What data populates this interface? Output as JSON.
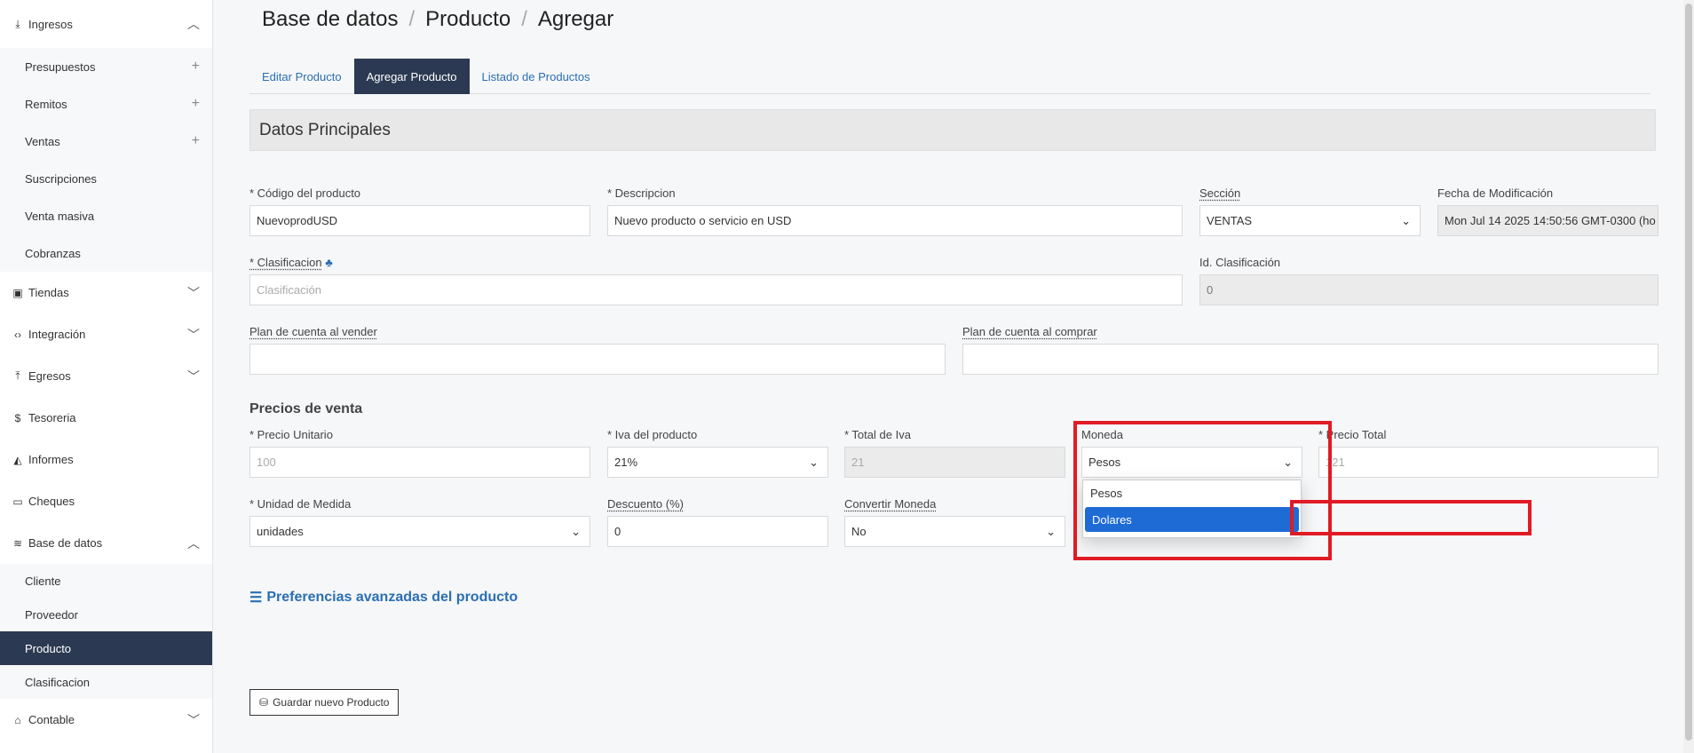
{
  "sidebar": {
    "ingresos": {
      "label": "Ingresos",
      "icon": "download-icon"
    },
    "ingresos_items": [
      {
        "label": "Presupuestos",
        "plus": "+"
      },
      {
        "label": "Remitos",
        "plus": "+"
      },
      {
        "label": "Ventas",
        "plus": "+"
      },
      {
        "label": "Suscripciones",
        "plus": ""
      },
      {
        "label": "Venta masiva",
        "plus": ""
      },
      {
        "label": "Cobranzas",
        "plus": ""
      }
    ],
    "tiendas": "Tiendas",
    "integracion": "Integración",
    "egresos": "Egresos",
    "tesoreria": "Tesoreria",
    "informes": "Informes",
    "cheques": "Cheques",
    "base_datos": "Base de datos",
    "base_items": [
      "Cliente",
      "Proveedor",
      "Producto",
      "Clasificacion"
    ],
    "contable": "Contable"
  },
  "breadcrumb": {
    "part1": "Base de datos",
    "part2": "Producto",
    "part3": "Agregar",
    "sep": "/"
  },
  "tabs": [
    "Editar Producto",
    "Agregar Producto",
    "Listado de Productos"
  ],
  "section_title": "Datos Principales",
  "fields": {
    "codigo": {
      "label": "* Código del producto",
      "value": "NuevoprodUSD"
    },
    "descripcion": {
      "label": "* Descripcion",
      "value": "Nuevo producto o servicio en USD"
    },
    "seccion": {
      "label": "Sección",
      "value": "VENTAS"
    },
    "fecha": {
      "label": "Fecha de Modificación",
      "value": "Mon Jul 14 2025 14:50:56 GMT-0300 (ho"
    },
    "clasificacion": {
      "label": "* Clasificacion",
      "placeholder": "Clasificación"
    },
    "id_clasificacion": {
      "label": "Id. Clasificación",
      "value": "0"
    },
    "plan_vender": {
      "label": "Plan de cuenta al vender",
      "value": ""
    },
    "plan_comprar": {
      "label": "Plan de cuenta al comprar",
      "value": ""
    },
    "precio_unitario": {
      "label": "* Precio Unitario",
      "placeholder": "100"
    },
    "iva": {
      "label": "* Iva del producto",
      "value": "21%"
    },
    "total_iva": {
      "label": "* Total de Iva",
      "value": "21"
    },
    "moneda": {
      "label": "Moneda",
      "value": "Pesos"
    },
    "precio_total": {
      "label": "* Precio Total",
      "placeholder": "121"
    },
    "unidad": {
      "label": "* Unidad de Medida",
      "value": "unidades"
    },
    "descuento": {
      "label": "Descuento (%)",
      "value": "0"
    },
    "convertir": {
      "label": "Convertir Moneda",
      "value": "No"
    }
  },
  "precios_heading": "Precios de venta",
  "moneda_options": [
    "Pesos",
    "Dolares"
  ],
  "advanced_link": "Preferencias avanzadas del producto",
  "save_button": "Guardar nuevo Producto",
  "colors": {
    "primary_dark": "#2b3a52",
    "link": "#2a6fb3",
    "highlight": "#1e6bd6",
    "annotation_red": "#e01b24"
  }
}
